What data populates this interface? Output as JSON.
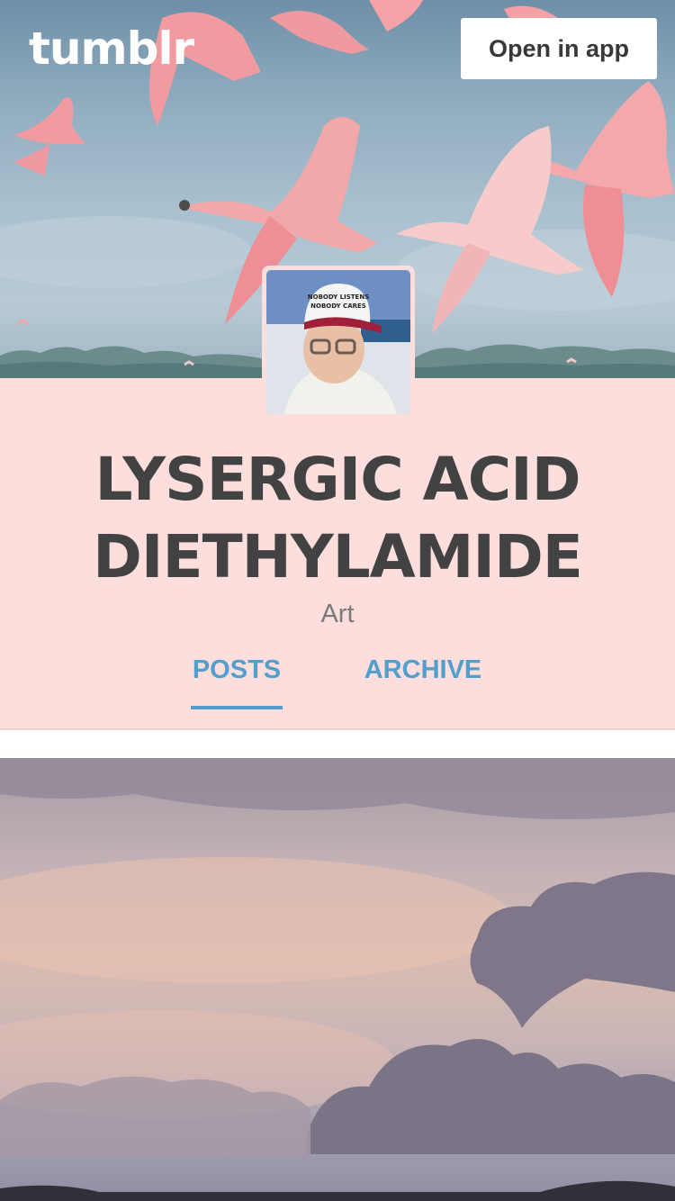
{
  "header": {
    "logo_text": "tumblr",
    "open_app_label": "Open in app"
  },
  "blog": {
    "title_line1": "LYSERGIC ACID",
    "title_line2": "DIETHYLAMIDE",
    "description": "Art",
    "avatar_hat_line1": "NOBODY LISTENS",
    "avatar_hat_line2": "NOBODY CARES"
  },
  "tabs": {
    "posts": "POSTS",
    "archive": "ARCHIVE",
    "active": "posts"
  },
  "colors": {
    "panel_background": "#fcdedd",
    "title_text": "#424242",
    "accent_blue": "#529ecc"
  }
}
